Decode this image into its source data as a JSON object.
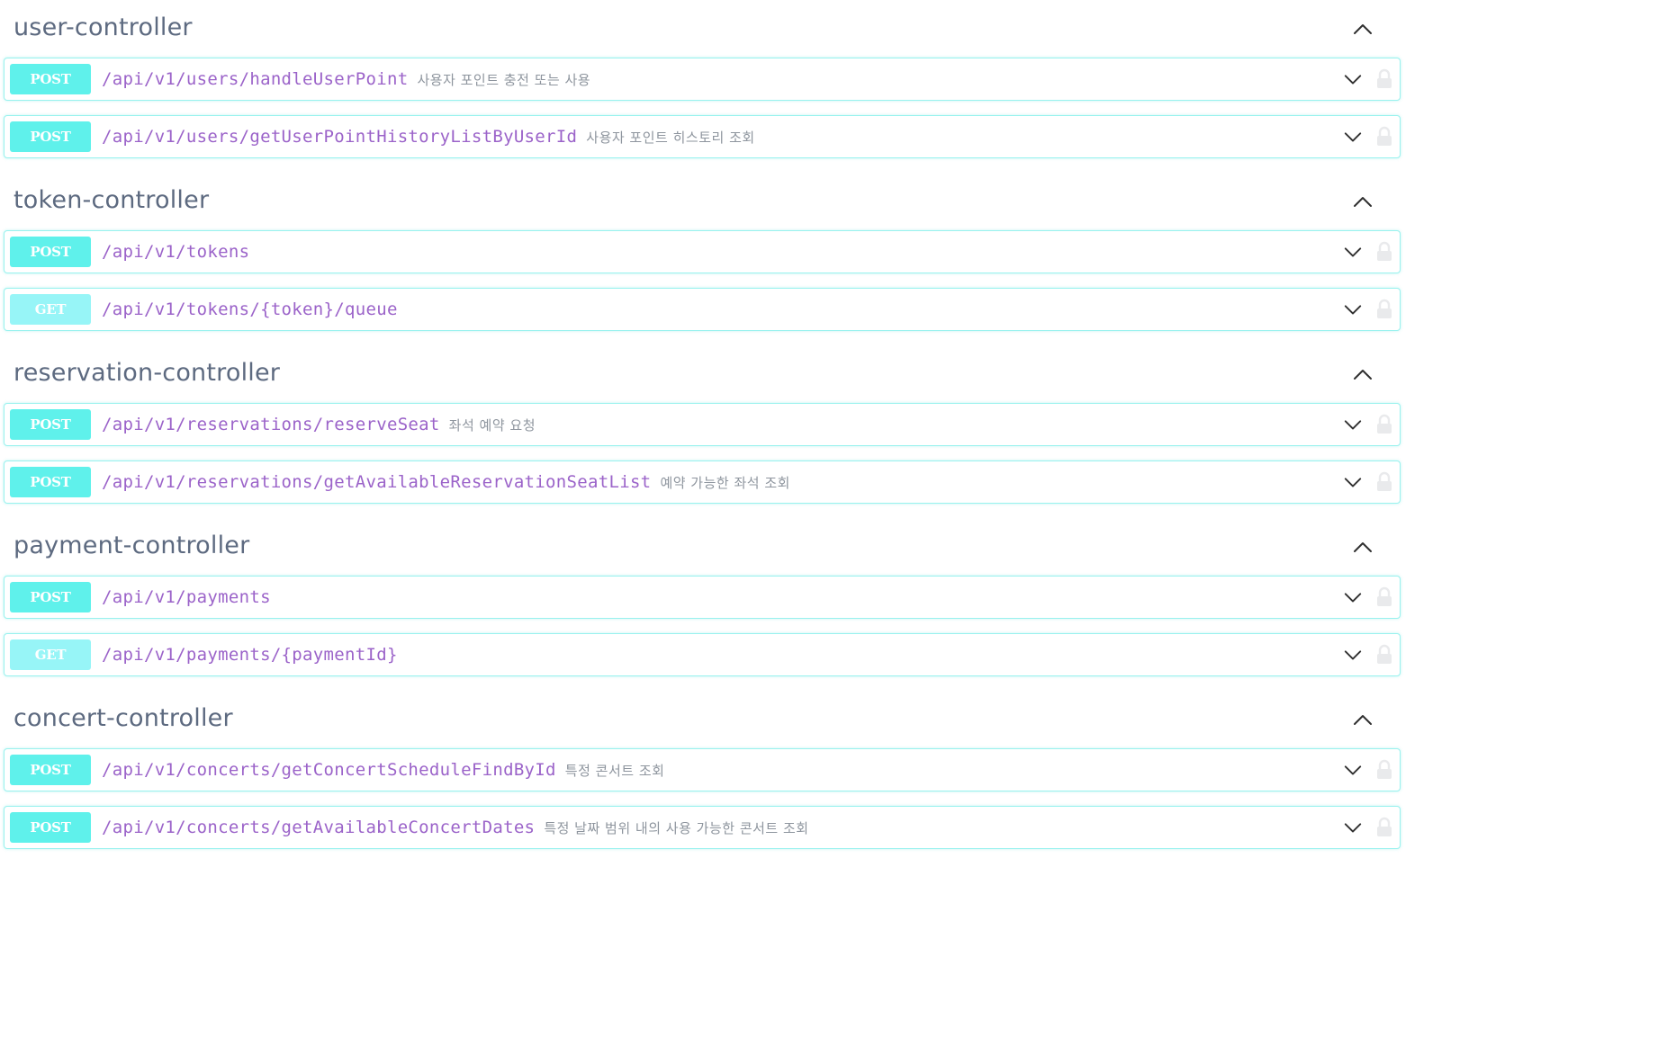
{
  "sections": [
    {
      "title": "user-controller",
      "ops": [
        {
          "method": "POST",
          "path": "/api/v1/users/handleUserPoint",
          "summary": "사용자 포인트 충전 또는 사용"
        },
        {
          "method": "POST",
          "path": "/api/v1/users/getUserPointHistoryListByUserId",
          "summary": "사용자 포인트 히스토리 조회"
        }
      ]
    },
    {
      "title": "token-controller",
      "ops": [
        {
          "method": "POST",
          "path": "/api/v1/tokens",
          "summary": ""
        },
        {
          "method": "GET",
          "path": "/api/v1/tokens/{token}/queue",
          "summary": ""
        }
      ]
    },
    {
      "title": "reservation-controller",
      "ops": [
        {
          "method": "POST",
          "path": "/api/v1/reservations/reserveSeat",
          "summary": "좌석 예약 요청"
        },
        {
          "method": "POST",
          "path": "/api/v1/reservations/getAvailableReservationSeatList",
          "summary": "예약 가능한 좌석 조회"
        }
      ]
    },
    {
      "title": "payment-controller",
      "ops": [
        {
          "method": "POST",
          "path": "/api/v1/payments",
          "summary": ""
        },
        {
          "method": "GET",
          "path": "/api/v1/payments/{paymentId}",
          "summary": ""
        }
      ]
    },
    {
      "title": "concert-controller",
      "ops": [
        {
          "method": "POST",
          "path": "/api/v1/concerts/getConcertScheduleFindById",
          "summary": "특정 콘서트 조회"
        },
        {
          "method": "POST",
          "path": "/api/v1/concerts/getAvailableConcertDates",
          "summary": "특정 날짜 범위 내의 사용 가능한 콘서트 조회"
        }
      ]
    }
  ],
  "icons": {
    "section_toggle": "chevron-up-icon",
    "op_toggle": "chevron-down-icon",
    "authorize": "lock-icon"
  },
  "colors": {
    "post": "#5ff1eb",
    "get": "#97f5f7",
    "border": "#99f2ee",
    "path": "#9b63c9",
    "title": "#5d6a80"
  }
}
